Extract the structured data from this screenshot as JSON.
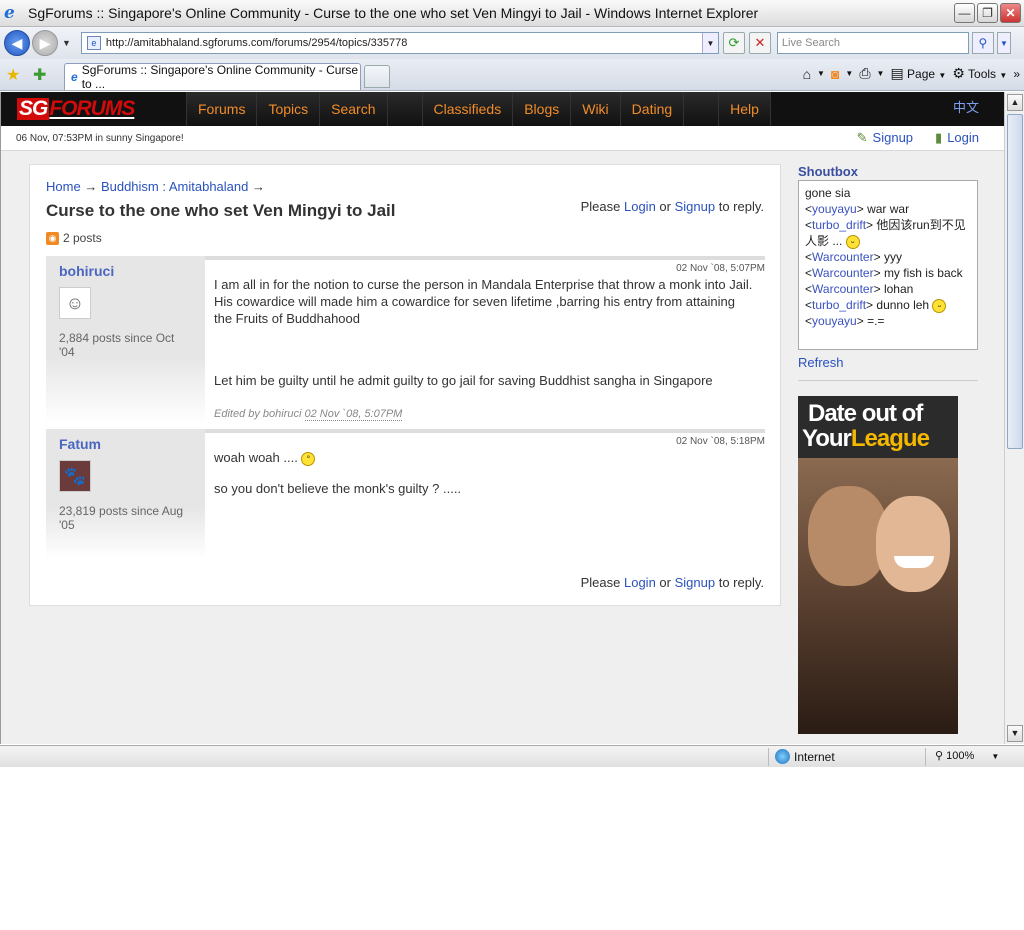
{
  "window": {
    "title": "SgForums :: Singapore's Online Community - Curse to the one who set Ven Mingyi to Jail - Windows Internet Explorer"
  },
  "toolbar": {
    "url": "http://amitabhaland.sgforums.com/forums/2954/topics/335778",
    "search_placeholder": "Live Search"
  },
  "tab": {
    "title": "SgForums :: Singapore's Online Community - Curse to ..."
  },
  "commands": {
    "page": "Page",
    "tools": "Tools"
  },
  "site": {
    "logo_sg": "SG",
    "logo_forums": "FORUMS",
    "nav": [
      "Forums",
      "Topics",
      "Search",
      "Classifieds",
      "Blogs",
      "Wiki",
      "Dating",
      "Help"
    ],
    "lang": "中文",
    "datetime": "06 Nov, 07:53PM in sunny Singapore!",
    "signup": "Signup",
    "login": "Login"
  },
  "breadcrumb": {
    "home": "Home",
    "forum": "Buddhism : Amitabhaland",
    "arrow": "→"
  },
  "topic": {
    "title": "Curse to the one who set Ven Mingyi to Jail",
    "post_count": "2 posts"
  },
  "reply": {
    "please": "Please",
    "login": "Login",
    "or": "or",
    "signup": "Signup",
    "to_reply": "to reply."
  },
  "posts": [
    {
      "author": "bohiruci",
      "stats": "2,884 posts since Oct '04",
      "date": "02 Nov `08, 5:07PM",
      "p1": "I am all in for the notion to curse the person in Mandala Enterprise that throw a monk into Jail. His cowardice will made him a cowardice for seven lifetime ,barring his entry from attaining the Fruits of Buddhahood",
      "p2": "Let him be guilty until he admit guilty to go jail for saving Buddhist sangha in Singapore",
      "edited_by": "Edited by bohiruci",
      "edited_date": "02 Nov `08, 5:07PM"
    },
    {
      "author": "Fatum",
      "stats": "23,819 posts since Aug '05",
      "date": "02 Nov `08, 5:18PM",
      "p1": "woah woah ....",
      "p2": "so you don't believe the monk's guilty ? ....."
    }
  ],
  "shoutbox": {
    "title": "Shoutbox",
    "lines": [
      {
        "user": "",
        "text": "gone sia"
      },
      {
        "user": "youyayu",
        "text": "war war"
      },
      {
        "user": "turbo_drift",
        "text": "他因该run到不见人影 ..."
      },
      {
        "user": "Warcounter",
        "text": "yyy"
      },
      {
        "user": "Warcounter",
        "text": "my fish is back"
      },
      {
        "user": "Warcounter",
        "text": "lohan"
      },
      {
        "user": "turbo_drift",
        "text": "dunno leh"
      },
      {
        "user": "youyayu",
        "text": "=.="
      }
    ],
    "refresh": "Refresh"
  },
  "ad": {
    "line1": "Date out of",
    "line2a": "Your",
    "line2b": "League"
  },
  "status": {
    "zone": "Internet",
    "zoom": "100%"
  }
}
